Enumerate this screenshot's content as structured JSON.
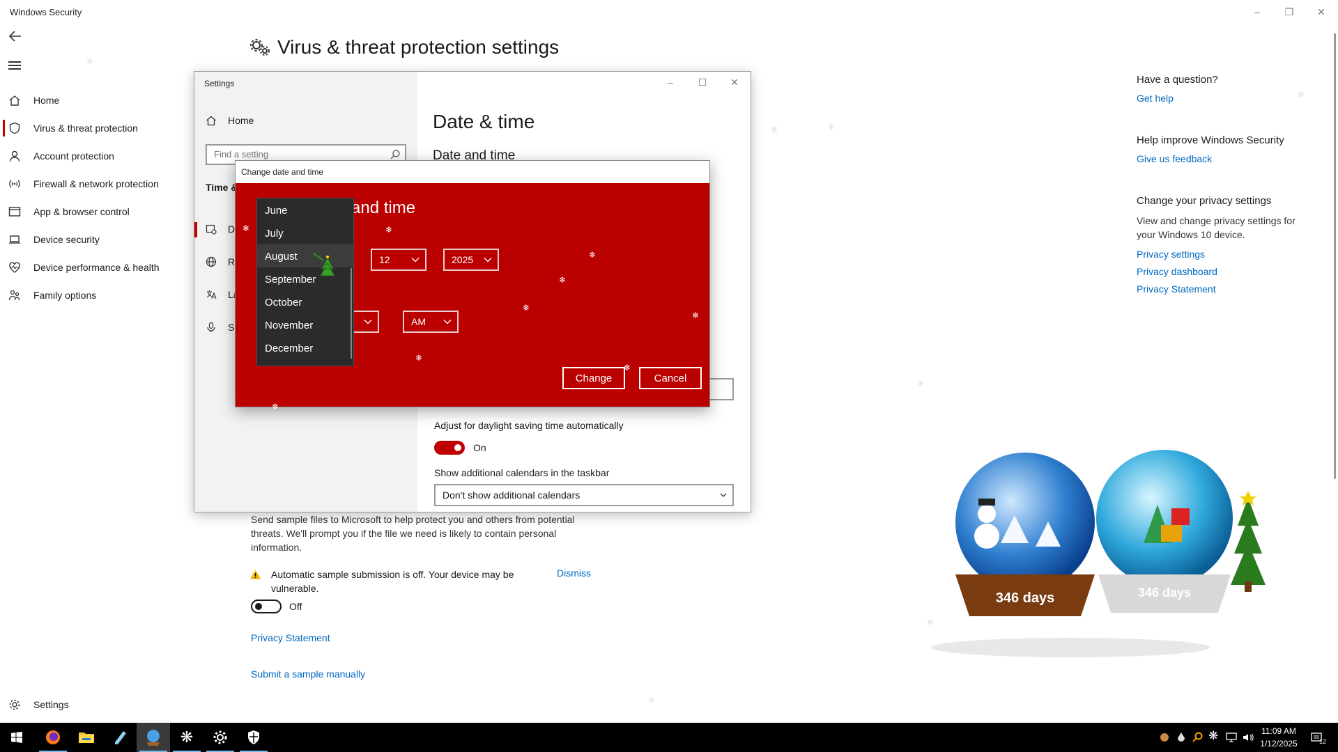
{
  "app": {
    "title": "Windows Security",
    "page_heading": "Virus & threat protection settings"
  },
  "nav": {
    "items": [
      {
        "label": "Home",
        "icon": "home-icon"
      },
      {
        "label": "Virus & threat protection",
        "icon": "shield-icon",
        "active": true
      },
      {
        "label": "Account protection",
        "icon": "person-icon"
      },
      {
        "label": "Firewall & network protection",
        "icon": "wifi-signal-icon"
      },
      {
        "label": "App & browser control",
        "icon": "browser-window-icon"
      },
      {
        "label": "Device security",
        "icon": "laptop-icon"
      },
      {
        "label": "Device performance & health",
        "icon": "heart-icon"
      },
      {
        "label": "Family options",
        "icon": "family-icon"
      }
    ],
    "settings_label": "Settings"
  },
  "main": {
    "sample_text": "Send sample files to Microsoft to help protect you and others from potential threats. We'll prompt you if the file we need is likely to contain personal information.",
    "warning_text": "Automatic sample submission is off. Your device may be vulnerable.",
    "dismiss_label": "Dismiss",
    "toggle_state": "Off",
    "privacy_link": "Privacy Statement",
    "submit_link": "Submit a sample manually"
  },
  "right": {
    "question_head": "Have a question?",
    "get_help": "Get help",
    "improve_head": "Help improve Windows Security",
    "feedback_link": "Give us feedback",
    "privacy_head": "Change your privacy settings",
    "privacy_text": "View and change privacy settings for your Windows 10 device.",
    "privacy_settings": "Privacy settings",
    "privacy_dashboard": "Privacy dashboard",
    "privacy_statement": "Privacy Statement"
  },
  "settings_window": {
    "title": "Settings",
    "home_label": "Home",
    "search_placeholder": "Find a setting",
    "section_head": "Time &",
    "nav": [
      {
        "label": "Da",
        "icon": "calendar-clock-icon"
      },
      {
        "label": "Re",
        "icon": "globe-icon"
      },
      {
        "label": "La",
        "icon": "language-icon"
      },
      {
        "label": "Sp",
        "icon": "microphone-icon"
      }
    ],
    "page_title": "Date & time",
    "subheading": "Date and time",
    "dst_label": "Adjust for daylight saving time automatically",
    "dst_state": "On",
    "calendars_label": "Show additional calendars in the taskbar",
    "calendars_value": "Don't show additional calendars"
  },
  "dialog": {
    "title": "Change date and time",
    "heading": "and time",
    "day": "12",
    "year": "2025",
    "ampm": "AM",
    "change_label": "Change",
    "cancel_label": "Cancel",
    "months": [
      "June",
      "July",
      "August",
      "September",
      "October",
      "November",
      "December"
    ],
    "hover_month": "August"
  },
  "globes": {
    "left_label": "346 days",
    "right_label": "346 days"
  },
  "taskbar": {
    "apps": [
      "windows-start-icon",
      "firefox-icon",
      "file-explorer-icon",
      "notepad-icon",
      "snow-globe-app-icon",
      "snowflake-app-icon",
      "settings-gear-icon",
      "windows-security-icon"
    ],
    "time": "11:09 AM",
    "date": "1/12/2025",
    "notification_count": "12"
  },
  "colors": {
    "accent_red": "#c00000",
    "dialog_red": "#bb0000",
    "link_blue": "#0067c0",
    "dropdown_bg": "#2b2b2b"
  }
}
